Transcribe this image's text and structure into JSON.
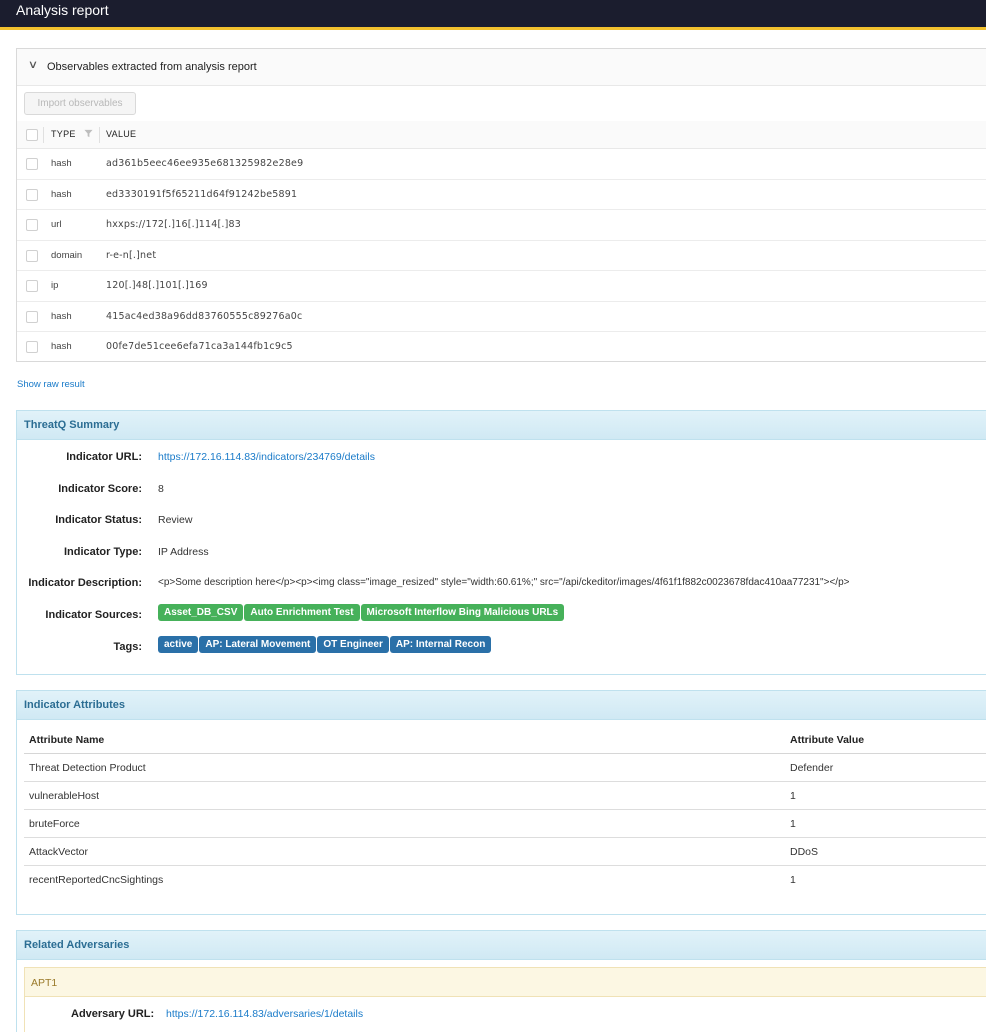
{
  "header": {
    "title": "Analysis report"
  },
  "observables": {
    "panel_title": "Observables extracted from analysis report",
    "import_button": "Import observables",
    "columns": {
      "type": "TYPE",
      "value": "VALUE"
    },
    "rows": [
      {
        "type": "hash",
        "value": "ad361b5eec46ee935e681325982e28e9"
      },
      {
        "type": "hash",
        "value": "ed3330191f5f65211d64f91242be5891"
      },
      {
        "type": "url",
        "value": "hxxps://172[.]16[.]114[.]83"
      },
      {
        "type": "domain",
        "value": "r-e-n[.]net"
      },
      {
        "type": "ip",
        "value": "120[.]48[.]101[.]169"
      },
      {
        "type": "hash",
        "value": "415ac4ed38a96dd83760555c89276a0c"
      },
      {
        "type": "hash",
        "value": "00fe7de51cee6efa71ca3a144fb1c9c5"
      }
    ],
    "raw_link": "Show raw result"
  },
  "summary": {
    "title": "ThreatQ Summary",
    "fields": {
      "url_label": "Indicator URL:",
      "url_value": "https://172.16.114.83/indicators/234769/details",
      "score_label": "Indicator Score:",
      "score_value": "8",
      "status_label": "Indicator Status:",
      "status_value": "Review",
      "type_label": "Indicator Type:",
      "type_value": "IP Address",
      "desc_label": "Indicator Description:",
      "desc_value": "<p>Some description here</p><p><img class=\"image_resized\" style=\"width:60.61%;\" src=\"/api/ckeditor/images/4f61f1f882c0023678fdac410aa77231\"></p>",
      "sources_label": "Indicator Sources:",
      "tags_label": "Tags:"
    },
    "sources": [
      "Asset_DB_CSV",
      "Auto Enrichment Test",
      "Microsoft Interflow Bing Malicious URLs"
    ],
    "tags": [
      "active",
      "AP: Lateral Movement",
      "OT Engineer",
      "AP: Internal Recon"
    ],
    "colors": {
      "source_badge": "#46b15a",
      "tag_badge": "#2a70a8",
      "link": "#1a7bc9"
    }
  },
  "attributes": {
    "title": "Indicator Attributes",
    "columns": {
      "name": "Attribute Name",
      "value": "Attribute Value"
    },
    "rows": [
      {
        "name": "Threat Detection Product",
        "value": "Defender"
      },
      {
        "name": "vulnerableHost",
        "value": "1"
      },
      {
        "name": "bruteForce",
        "value": "1"
      },
      {
        "name": "AttackVector",
        "value": "DDoS"
      },
      {
        "name": "recentReportedCncSightings",
        "value": "1"
      }
    ]
  },
  "adversaries": {
    "title": "Related Adversaries",
    "items": [
      {
        "name": "APT1",
        "url_label": "Adversary URL:",
        "url_value": "https://172.16.114.83/adversaries/1/details"
      }
    ]
  }
}
